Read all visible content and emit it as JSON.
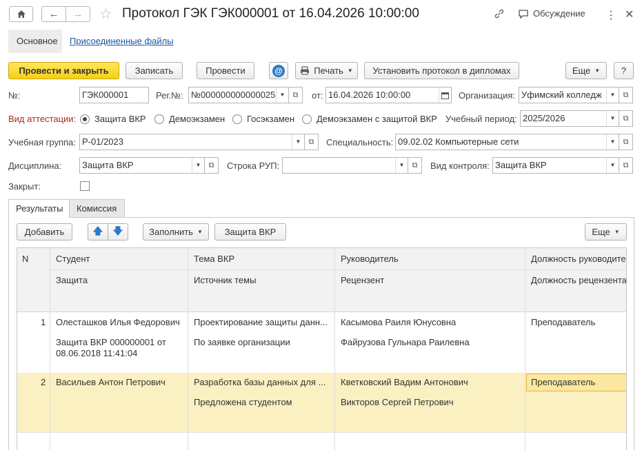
{
  "window": {
    "title": "Протокол ГЭК ГЭК000001 от 16.04.2026 10:00:00",
    "discussion_label": "Обсуждение"
  },
  "sections": {
    "main": "Основное",
    "attached_files": "Присоединенные файлы"
  },
  "toolbar": {
    "post_and_close": "Провести и закрыть",
    "write": "Записать",
    "post": "Провести",
    "print": "Печать",
    "set_protocol": "Установить протокол в дипломах",
    "more": "Еще",
    "help": "?"
  },
  "form": {
    "number_label": "№:",
    "number_value": "ГЭК000001",
    "reg_label": "Рег.№:",
    "reg_value": "№000000000000025",
    "from_label": "от:",
    "date_value": "16.04.2026 10:00:00",
    "org_label": "Организация:",
    "org_value": "Уфимский колледж",
    "attestation_label": "Вид аттестации:",
    "attestation_options": [
      "Защита ВКР",
      "Демоэкзамен",
      "Госэкзамен",
      "Демоэкзамен с защитой ВКР"
    ],
    "attestation_selected": 0,
    "period_label": "Учебный период:",
    "period_value": "2025/2026",
    "group_label": "Учебная группа:",
    "group_value": "Р-01/2023",
    "specialty_label": "Специальность:",
    "specialty_value": "09.02.02 Компьютерные сети",
    "discipline_label": "Дисциплина:",
    "discipline_value": "Защита ВКР",
    "rup_label": "Строка РУП:",
    "rup_value": "",
    "control_label": "Вид контроля:",
    "control_value": "Защита ВКР",
    "closed_label": "Закрыт:",
    "closed_checked": false
  },
  "tabs": {
    "results": "Результаты",
    "commission": "Комиссия"
  },
  "table_toolbar": {
    "add": "Добавить",
    "fill": "Заполнить",
    "defense": "Защита ВКР",
    "more": "Еще"
  },
  "table": {
    "headers": {
      "n": "N",
      "student": "Студент",
      "defense": "Защита",
      "topic": "Тема ВКР",
      "topic_source": "Источник темы",
      "supervisor": "Руководитель",
      "reviewer": "Рецензент",
      "supervisor_position": "Должность руководите",
      "reviewer_position": "Должность рецензента"
    },
    "rows": [
      {
        "n": "1",
        "student": "Олесташков Илья Федорович",
        "defense_line1": "Защита ВКР 000000001 от",
        "defense_line2": "08.06.2018 11:41:04",
        "topic": "Проектирование защиты данн...",
        "topic_source": "По заявке организации",
        "supervisor": "Касымова Раиля Юнусовна",
        "reviewer": "Файрузова Гульнара Раилевна",
        "supervisor_position": "Преподаватель",
        "reviewer_position": ""
      },
      {
        "n": "2",
        "student": "Васильев Антон Петрович",
        "defense_line1": "",
        "defense_line2": "",
        "topic": "Разработка базы данных для ...",
        "topic_source": "Предложена студентом",
        "supervisor": "Кветковский Вадим Антонович",
        "reviewer": "Викторов Сергей Петрович",
        "supervisor_position": "Преподаватель",
        "reviewer_position": ""
      }
    ]
  }
}
